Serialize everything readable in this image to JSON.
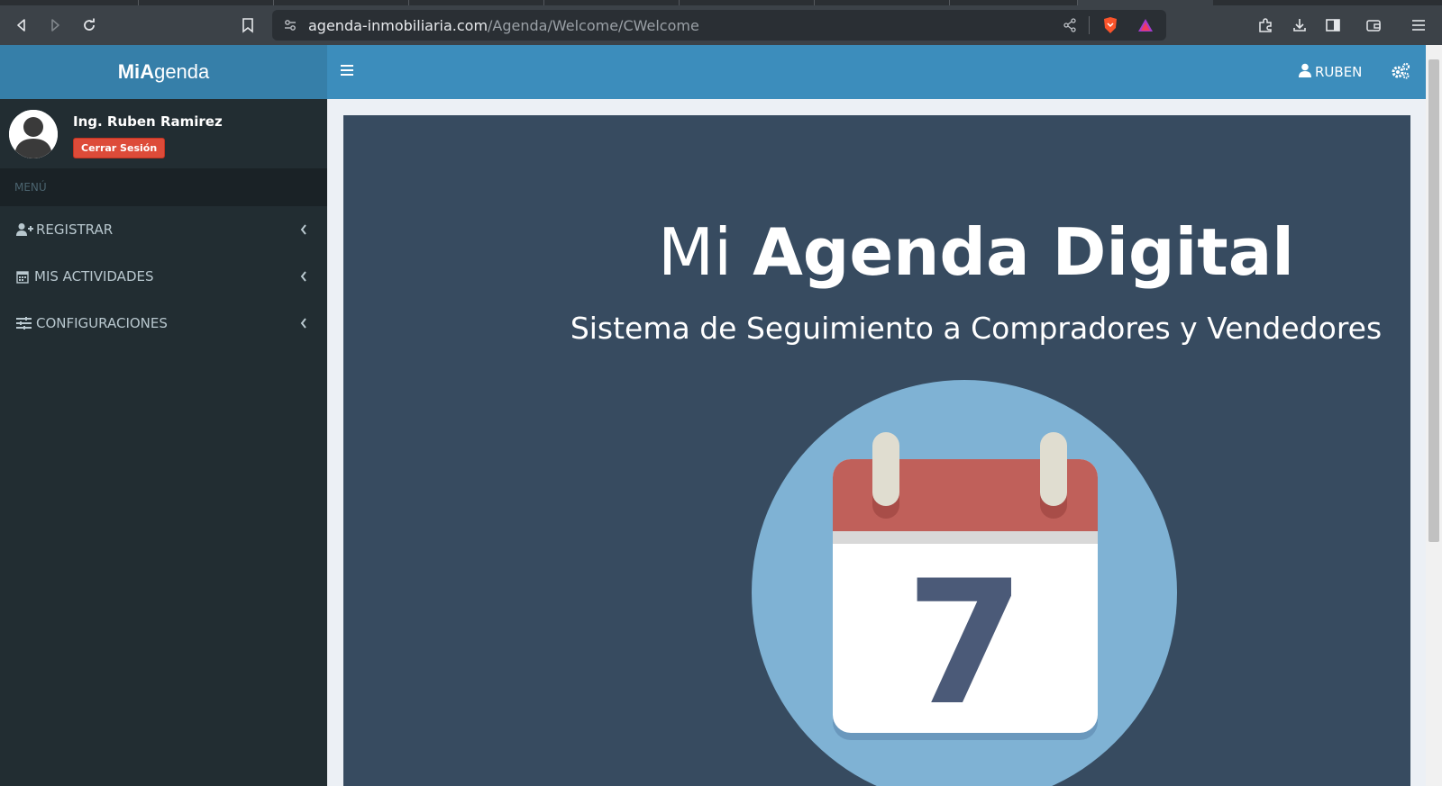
{
  "browser": {
    "url_domain": "agenda-inmobiliaria.com",
    "url_path": "/Agenda/Welcome/CWelcome"
  },
  "app": {
    "logo_bold_1": "Mi ",
    "logo_bold_2": "A",
    "logo_rest": "genda",
    "user_menu_label": "RUBEN"
  },
  "sidebar": {
    "user_name": "Ing. Ruben Ramirez",
    "logout_label": "Cerrar Sesión",
    "menu_header": "MENÚ",
    "items": [
      {
        "label": "REGISTRAR",
        "icon": "user-plus-icon"
      },
      {
        "label": "MIS ACTIVIDADES",
        "icon": "calendar-icon"
      },
      {
        "label": "CONFIGURACIONES",
        "icon": "sliders-icon"
      }
    ]
  },
  "main": {
    "title_light": "Mi ",
    "title_bold": "Agenda Digital",
    "subtitle": "Sistema de Seguimiento a Compradores y Vendedores",
    "calendar_day": "7"
  },
  "colors": {
    "header_blue": "#3c8dbc",
    "logo_blue": "#367fa9",
    "sidebar_dark": "#222d32",
    "content_bg": "#374b60",
    "logout_red": "#dd4b39"
  }
}
